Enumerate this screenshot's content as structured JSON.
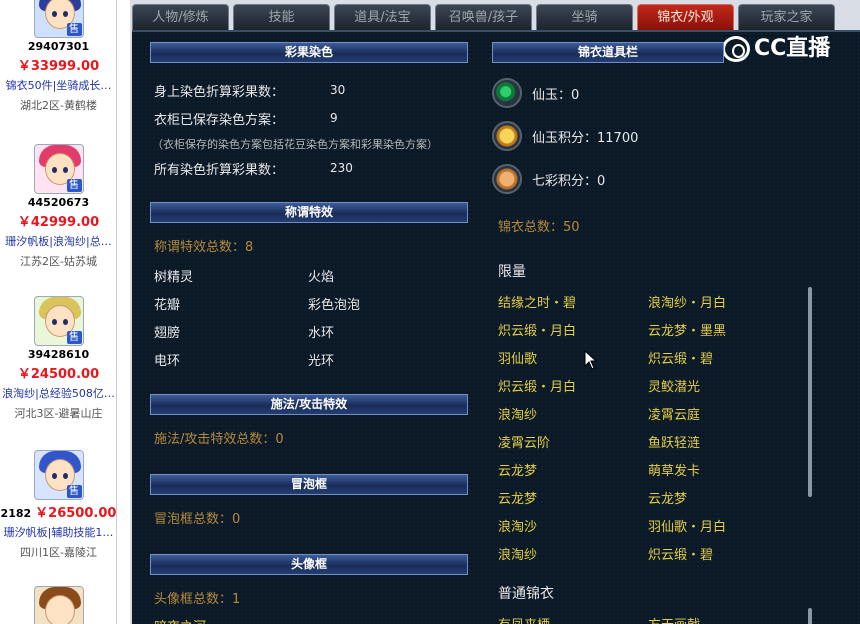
{
  "left_listings": [
    {
      "id": "29407301",
      "price": "￥33999.00",
      "desc": "锦衣50件|坐骑成长…",
      "server": "湖北2区-黄鹤楼"
    },
    {
      "id": "44520673",
      "price": "￥42999.00",
      "desc": "珊汐帆板|浪淘纱|总…",
      "server": "江苏2区-姑苏城"
    },
    {
      "id": "39428610",
      "price": "￥24500.00",
      "desc": "浪淘纱|总经验508亿…",
      "server": "河北3区-避暑山庄"
    },
    {
      "id": "2182",
      "price": "￥26500.00",
      "desc": "珊汐帆板|辅助技能1…",
      "server": "四川1区-嘉陵江"
    }
  ],
  "sell_badge": "售",
  "tabs": [
    "人物/修炼",
    "技能",
    "道具/法宝",
    "召唤兽/孩子",
    "坐骑",
    "锦衣/外观",
    "玩家之家"
  ],
  "active_tab": "锦衣/外观",
  "watermark": "CC直播",
  "dye": {
    "header": "彩果染色",
    "rows": [
      {
        "label": "身上染色折算彩果数：",
        "value": "30"
      },
      {
        "label": "衣柜已保存染色方案：",
        "value": "9"
      }
    ],
    "note": "（衣柜保存的染色方案包括花豆染色方案和彩果染色方案）",
    "total_label": "所有染色折算彩果数：",
    "total_value": "230"
  },
  "title_effects": {
    "header": "称谓特效",
    "count": "称谓特效总数：8",
    "items": [
      "树精灵",
      "火焰",
      "花瓣",
      "彩色泡泡",
      "翅膀",
      "水环",
      "电环",
      "光环"
    ]
  },
  "cast_effects": {
    "header": "施法/攻击特效",
    "count": "施法/攻击特效总数：0"
  },
  "bubble_frames": {
    "header": "冒泡框",
    "count": "冒泡框总数：0"
  },
  "avatar_frames": {
    "header": "头像框",
    "count": "头像框总数：1",
    "partial": "暗夜之河"
  },
  "wardrobe_items": {
    "header": "锦衣道具栏",
    "currencies": [
      {
        "label": "仙玉：0",
        "icon": "jade-icon"
      },
      {
        "label": "仙玉积分：11700",
        "icon": "jade-points-icon"
      },
      {
        "label": "七彩积分：0",
        "icon": "rainbow-points-icon"
      }
    ],
    "total": "锦衣总数：50",
    "limited_label": "限量",
    "limited_items": [
      "结缘之时・碧",
      "浪淘纱・月白",
      "炽云缎・月白",
      "云龙梦・墨黑",
      "羽仙歌",
      "炽云缎・碧",
      "炽云缎・月白",
      "灵鲛潜光",
      "浪淘纱",
      "凌霄云庭",
      "凌霄云阶",
      "鱼跃轻涟",
      "云龙梦",
      "萌草发卡",
      "云龙梦",
      "云龙梦",
      "浪淘沙",
      "羽仙歌・月白",
      "浪淘纱",
      "炽云缎・碧"
    ],
    "normal_label": "普通锦衣",
    "normal_items": [
      "有凤来栖",
      "方天画戟"
    ]
  },
  "colors": {
    "active_tab": "#a8190e",
    "gold_text": "#b58a3a",
    "item_text": "#e4cf45",
    "price": "#e8161d"
  }
}
